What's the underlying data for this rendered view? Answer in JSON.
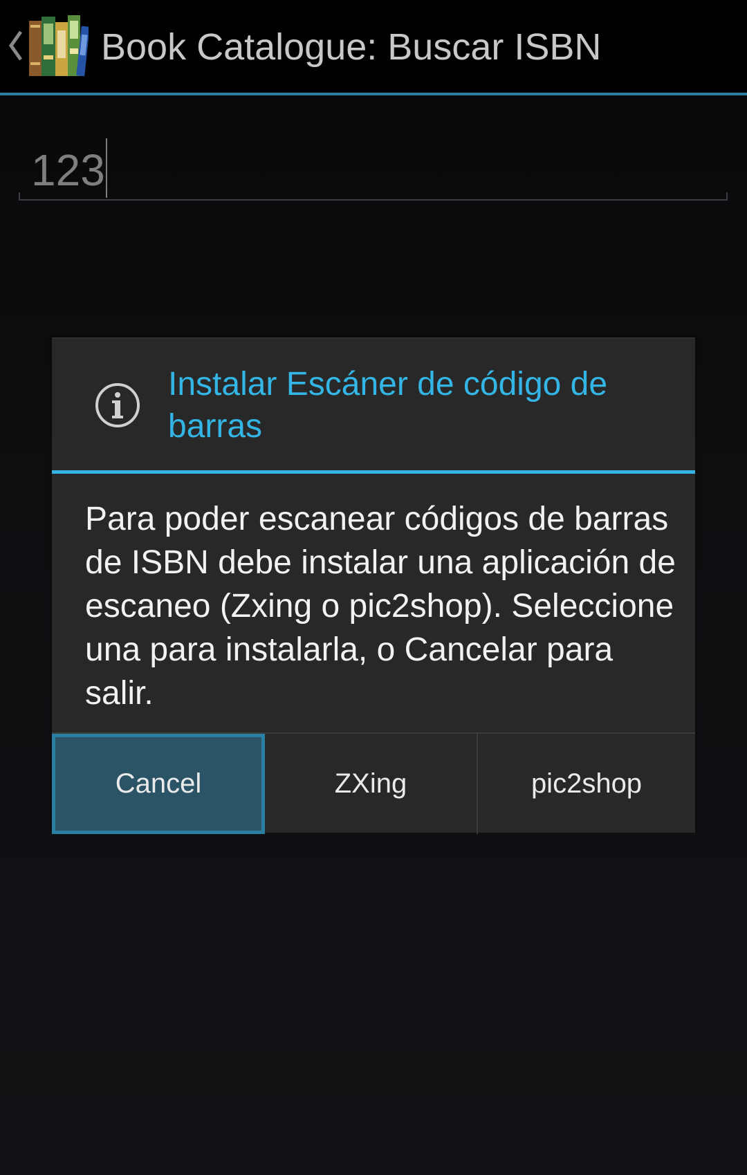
{
  "action_bar": {
    "title": "Book Catalogue: Buscar ISBN",
    "up_icon": "chevron-left-icon",
    "app_icon": "books-app-icon",
    "accent_color": "#2b7ea1"
  },
  "isbn_input": {
    "value": "123"
  },
  "dialog": {
    "icon": "info-icon",
    "title": "Instalar Escáner de código de barras",
    "title_color": "#33b5e5",
    "message": "Para poder escanear códigos de barras de ISBN debe instalar una aplicación de escaneo (Zxing o pic2shop). Seleccione una para instalarla, o Cancelar para salir.",
    "buttons": {
      "cancel": "Cancel",
      "zxing": "ZXing",
      "pic2shop": "pic2shop"
    },
    "focused_button_color": "#2b5566"
  }
}
